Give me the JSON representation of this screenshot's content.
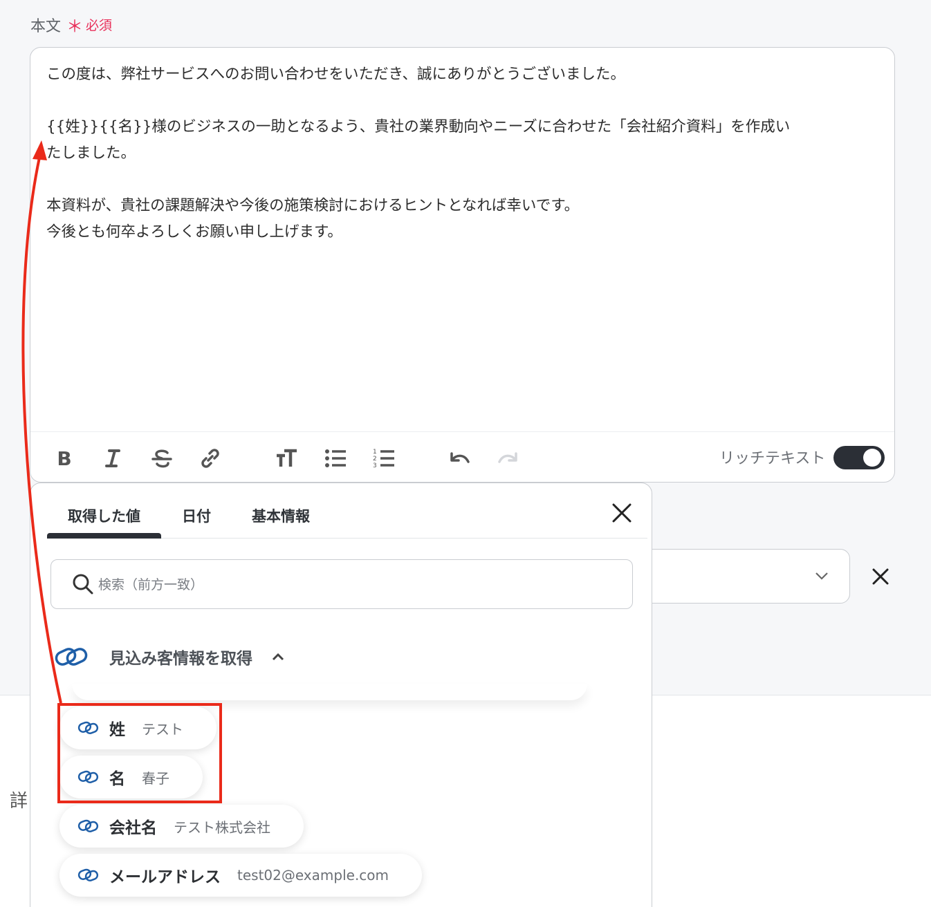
{
  "field": {
    "label": "本文",
    "required_mark": "＊",
    "required_text": "必須"
  },
  "editor": {
    "lines": [
      "この度は、弊社サービスへのお問い合わせをいただき、誠にありがとうございました。",
      "",
      "{{姓}}{{名}}様のビジネスの一助となるよう、貴社の業界動向やニーズに合わせた「会社紹介資料」を作成い",
      "たしました。",
      "",
      "本資料が、貴社の課題解決や今後の施策検討におけるヒントとなれば幸いです。",
      "今後とも何卒よろしくお願い申し上げます。"
    ],
    "toolbar_icons": [
      "bold-icon",
      "italic-icon",
      "strikethrough-icon",
      "link-icon",
      "text-size-icon",
      "bullet-list-icon",
      "numbered-list-icon",
      "undo-icon",
      "redo-icon"
    ],
    "rich_text_label": "リッチテキスト",
    "rich_text_enabled": true
  },
  "popup": {
    "tabs": [
      {
        "label": "取得した値",
        "active": true
      },
      {
        "label": "日付",
        "active": false
      },
      {
        "label": "基本情報",
        "active": false
      }
    ],
    "search_placeholder": "検索（前方一致）",
    "section_title": "見込み客情報を取得",
    "items": [
      {
        "name": "姓",
        "value": "テスト"
      },
      {
        "name": "名",
        "value": "春子"
      },
      {
        "name": "会社名",
        "value": "テスト株式会社"
      },
      {
        "name": "メールアドレス",
        "value": "test02@example.com"
      }
    ]
  },
  "background": {
    "partial_label": "詳"
  },
  "colors": {
    "accent_red": "#ea2a1a",
    "required_pink": "#e8305a",
    "link_icon_blue": "#1f5fa8",
    "toggle_dark": "#2b2f36"
  }
}
